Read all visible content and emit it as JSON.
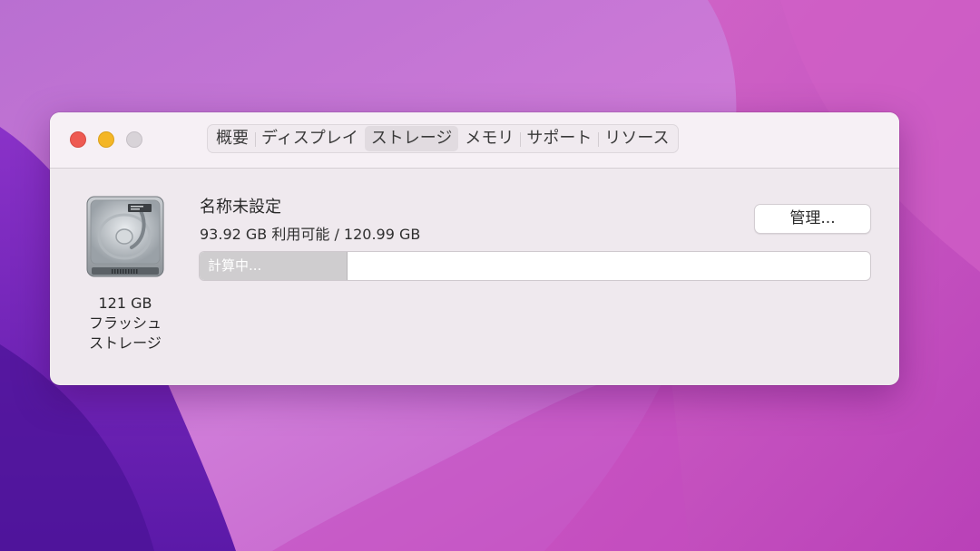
{
  "window": {
    "tabs": [
      {
        "label": "概要",
        "active": false
      },
      {
        "label": "ディスプレイ",
        "active": false
      },
      {
        "label": "ストレージ",
        "active": true
      },
      {
        "label": "メモリ",
        "active": false
      },
      {
        "label": "サポート",
        "active": false
      },
      {
        "label": "リソース",
        "active": false
      }
    ]
  },
  "storage": {
    "disk": {
      "icon": "hard-drive-icon",
      "caption_size": "121 GB",
      "caption_line2": "フラッシュ",
      "caption_line3": "ストレージ"
    },
    "volume_name": "名称未設定",
    "availability": "93.92 GB 利用可能 / 120.99 GB",
    "manage_label": "管理...",
    "bar": {
      "label": "計算中...",
      "fill_fraction": 0.22
    }
  },
  "colors": {
    "close": "#ee5a52",
    "minimize": "#f4b626",
    "zoom_disabled": "#d8d3d8",
    "wallpaper_base": "#c45ec9"
  }
}
